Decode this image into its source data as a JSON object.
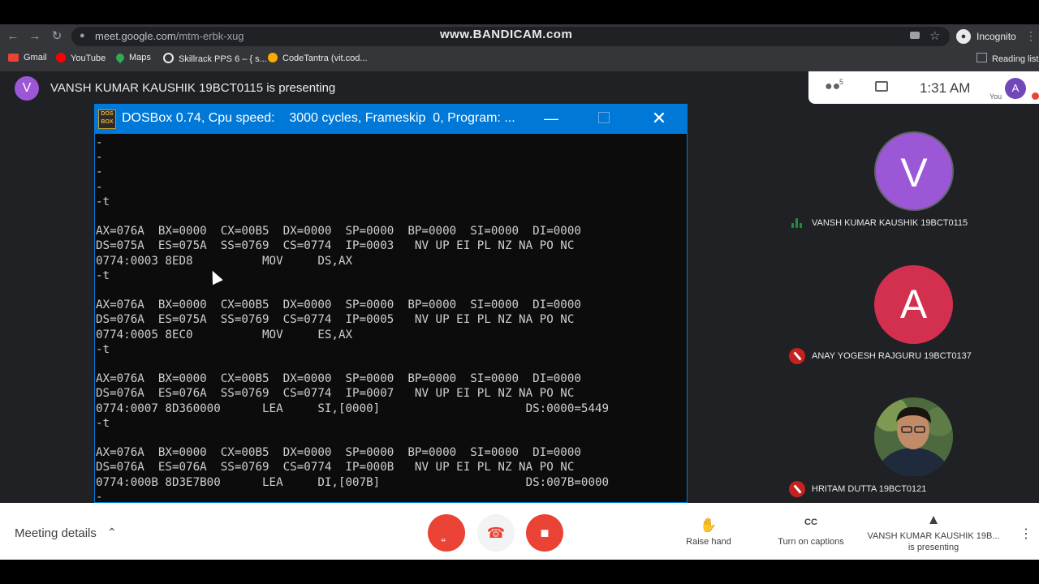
{
  "browser": {
    "url_host": "meet.google.com",
    "url_path": "/mtm-erbk-xug",
    "watermark": "www.BANDICAM.com",
    "incognito_label": "Incognito",
    "reading_list_label": "Reading list",
    "bookmarks": [
      {
        "label": "Gmail",
        "icon": "gmail-icon",
        "color": "#ea4335"
      },
      {
        "label": "YouTube",
        "icon": "youtube-icon",
        "color": "#ff0000"
      },
      {
        "label": "Maps",
        "icon": "maps-icon",
        "color": "#34a853"
      },
      {
        "label": "Skillrack PPS 6 – { s...",
        "icon": "globe-icon",
        "color": "#e8eaed"
      },
      {
        "label": "CodeTantra (vit.cod...",
        "icon": "codetantra-icon",
        "color": "#f9ab00"
      }
    ]
  },
  "meet": {
    "presenter_initial": "V",
    "presenting_text": "VANSH KUMAR KAUSHIK 19BCT0115 is presenting",
    "people_count": "5",
    "clock": "1:31 AM",
    "self_initial": "A",
    "self_label": "You",
    "participants": [
      {
        "initial": "V",
        "name": "VANSH KUMAR KAUSHIK 19BCT0115",
        "color": "#9c57d6",
        "speaking": true
      },
      {
        "initial": "A",
        "name": "ANAY YOGESH RAJGURU 19BCT0137",
        "color": "#d32f4f",
        "muted": true
      },
      {
        "initial": "",
        "name": "HRITAM DUTTA 19BCT0121",
        "muted": true
      }
    ],
    "bottom": {
      "meeting_details": "Meeting details",
      "raise_hand": "Raise hand",
      "captions": "Turn on captions",
      "presenting_name": "VANSH KUMAR KAUSHIK 19B...",
      "presenting_sub": "is presenting"
    }
  },
  "dosbox": {
    "title": "DOSBox 0.74, Cpu speed:    3000 cycles, Frameskip  0, Program: ...",
    "logo": "DOS BOX",
    "lines": [
      "-",
      "-",
      "-",
      "-",
      "-t",
      "",
      "AX=076A  BX=0000  CX=00B5  DX=0000  SP=0000  BP=0000  SI=0000  DI=0000",
      "DS=075A  ES=075A  SS=0769  CS=0774  IP=0003   NV UP EI PL NZ NA PO NC",
      "0774:0003 8ED8          MOV     DS,AX",
      "-t",
      "",
      "AX=076A  BX=0000  CX=00B5  DX=0000  SP=0000  BP=0000  SI=0000  DI=0000",
      "DS=076A  ES=075A  SS=0769  CS=0774  IP=0005   NV UP EI PL NZ NA PO NC",
      "0774:0005 8EC0          MOV     ES,AX",
      "-t",
      "",
      "AX=076A  BX=0000  CX=00B5  DX=0000  SP=0000  BP=0000  SI=0000  DI=0000",
      "DS=076A  ES=076A  SS=0769  CS=0774  IP=0007   NV UP EI PL NZ NA PO NC",
      "0774:0007 8D360000      LEA     SI,[0000]                     DS:0000=5449",
      "-t",
      "",
      "AX=076A  BX=0000  CX=00B5  DX=0000  SP=0000  BP=0000  SI=0000  DI=0000",
      "DS=076A  ES=076A  SS=0769  CS=0774  IP=000B   NV UP EI PL NZ NA PO NC",
      "0774:000B 8D3E7B00      LEA     DI,[007B]                     DS:007B=0000",
      "-"
    ]
  }
}
